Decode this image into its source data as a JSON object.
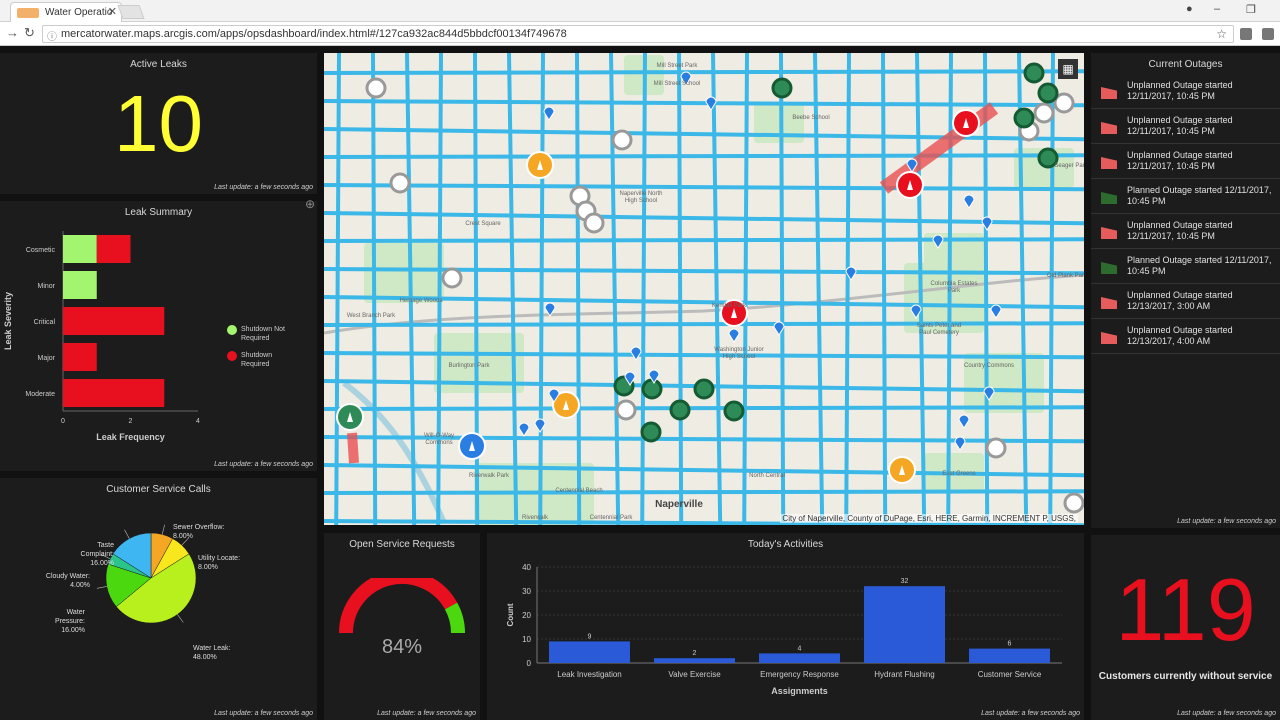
{
  "browser": {
    "tab_title": "Water Operatio",
    "url": "mercatorwater.maps.arcgis.com/apps/opsdashboard/index.html#/127ca932ac844d5bbdcf00134f749678"
  },
  "active_leaks": {
    "title": "Active Leaks",
    "value": "10",
    "last_update": "Last update: a few seconds ago",
    "color": "#ffff33"
  },
  "leak_summary": {
    "title": "Leak Summary",
    "last_update": "Last update: a few seconds ago",
    "legend": [
      {
        "label": "Shutdown Not Required",
        "color": "#a3f56f"
      },
      {
        "label": "Shutdown Required",
        "color": "#e8101f"
      }
    ],
    "chart_data": {
      "type": "bar",
      "orientation": "horizontal",
      "stacked": true,
      "categories": [
        "Cosmetic",
        "Minor",
        "Critical",
        "Major",
        "Moderate"
      ],
      "series": [
        {
          "name": "Shutdown Not Required",
          "values": [
            1,
            1,
            0,
            0,
            0
          ]
        },
        {
          "name": "Shutdown Required",
          "values": [
            1,
            0,
            3,
            1,
            3
          ]
        }
      ],
      "xlabel": "Leak Frequency",
      "ylabel": "Leak Severity",
      "xlim": [
        0,
        4
      ],
      "xticks": [
        "0",
        "2",
        "4"
      ]
    }
  },
  "customer_calls": {
    "title": "Customer Service Calls",
    "last_update": "Last update: a few seconds ago",
    "chart_data": {
      "type": "pie",
      "slices": [
        {
          "label": "Sewer Overflow:",
          "pct_label": "8.00%",
          "value": 8,
          "color": "#f5a623"
        },
        {
          "label": "Utility Locate:",
          "pct_label": "8.00%",
          "value": 8,
          "color": "#f8e71c"
        },
        {
          "label": "Water Leak:",
          "pct_label": "48.00%",
          "value": 48,
          "color": "#b8f01e"
        },
        {
          "label": "Water Pressure:",
          "pct_label": "16.00%",
          "value": 16,
          "color": "#4cd80f"
        },
        {
          "label": "Cloudy Water:",
          "pct_label": "4.00%",
          "value": 4,
          "color": "#2bc48a"
        },
        {
          "label": "Taste Complaint:",
          "pct_label": "16.00%",
          "value": 16,
          "color": "#3db6f2"
        }
      ]
    }
  },
  "open_requests": {
    "title": "Open Service Requests",
    "value_label": "84%",
    "value": 84,
    "last_update": "Last update: a few seconds ago"
  },
  "activities": {
    "title": "Today's Activities",
    "last_update": "Last update: a few seconds ago",
    "chart_data": {
      "type": "bar",
      "categories": [
        "Leak Investigation",
        "Valve Exercise",
        "Emergency Response",
        "Hydrant Flushing",
        "Customer Service"
      ],
      "values": [
        9,
        2,
        4,
        32,
        6
      ],
      "xlabel": "Assignments",
      "ylabel": "Count",
      "ylim": [
        0,
        40
      ],
      "yticks": [
        "0",
        "10",
        "20",
        "30",
        "40"
      ],
      "color": "#2a5ad8"
    }
  },
  "outages": {
    "title": "Current Outages",
    "last_update": "Last update: a few seconds ago",
    "items": [
      {
        "text": "Unplanned Outage started 12/11/2017, 10:45 PM",
        "type": "unplanned"
      },
      {
        "text": "Unplanned Outage started 12/11/2017, 10:45 PM",
        "type": "unplanned"
      },
      {
        "text": "Unplanned Outage started 12/11/2017, 10:45 PM",
        "type": "unplanned"
      },
      {
        "text": "Planned Outage started 12/11/2017, 10:45 PM",
        "type": "planned"
      },
      {
        "text": "Unplanned Outage started 12/11/2017, 10:45 PM",
        "type": "unplanned"
      },
      {
        "text": "Planned Outage started 12/11/2017, 10:45 PM",
        "type": "planned"
      },
      {
        "text": "Unplanned Outage started 12/13/2017, 3:00 AM",
        "type": "unplanned"
      },
      {
        "text": "Unplanned Outage started 12/13/2017, 4:00 AM",
        "type": "unplanned"
      }
    ],
    "colors": {
      "unplanned": "#e65c5c",
      "planned": "#2e6b2e"
    }
  },
  "customers_out": {
    "value": "119",
    "label": "Customers currently without service",
    "last_update": "Last update: a few seconds ago",
    "color": "#e8101f"
  },
  "map": {
    "attribution": "City of Naperville, County of DuPage, Esri, HERE, Garmin, INCREMENT P, USGS,",
    "labels": [
      "Mill Street Park",
      "Mill Street School",
      "Beebe School",
      "Naperville North High School",
      "Crest Square",
      "Heritage Woods",
      "West Branch Park",
      "Burlington Park",
      "Kendall Park",
      "Washington Junior High School",
      "Saints Peter and Paul Cemetery",
      "Country Commons",
      "Old Plank Park",
      "Columbia Estates Park",
      "Seager Park",
      "Riverwalk Park",
      "Centennial Beach",
      "Centennial Park",
      "Will-O-Way Commons",
      "North Central",
      "East Greens",
      "Naperville",
      "Riverwalk"
    ]
  }
}
